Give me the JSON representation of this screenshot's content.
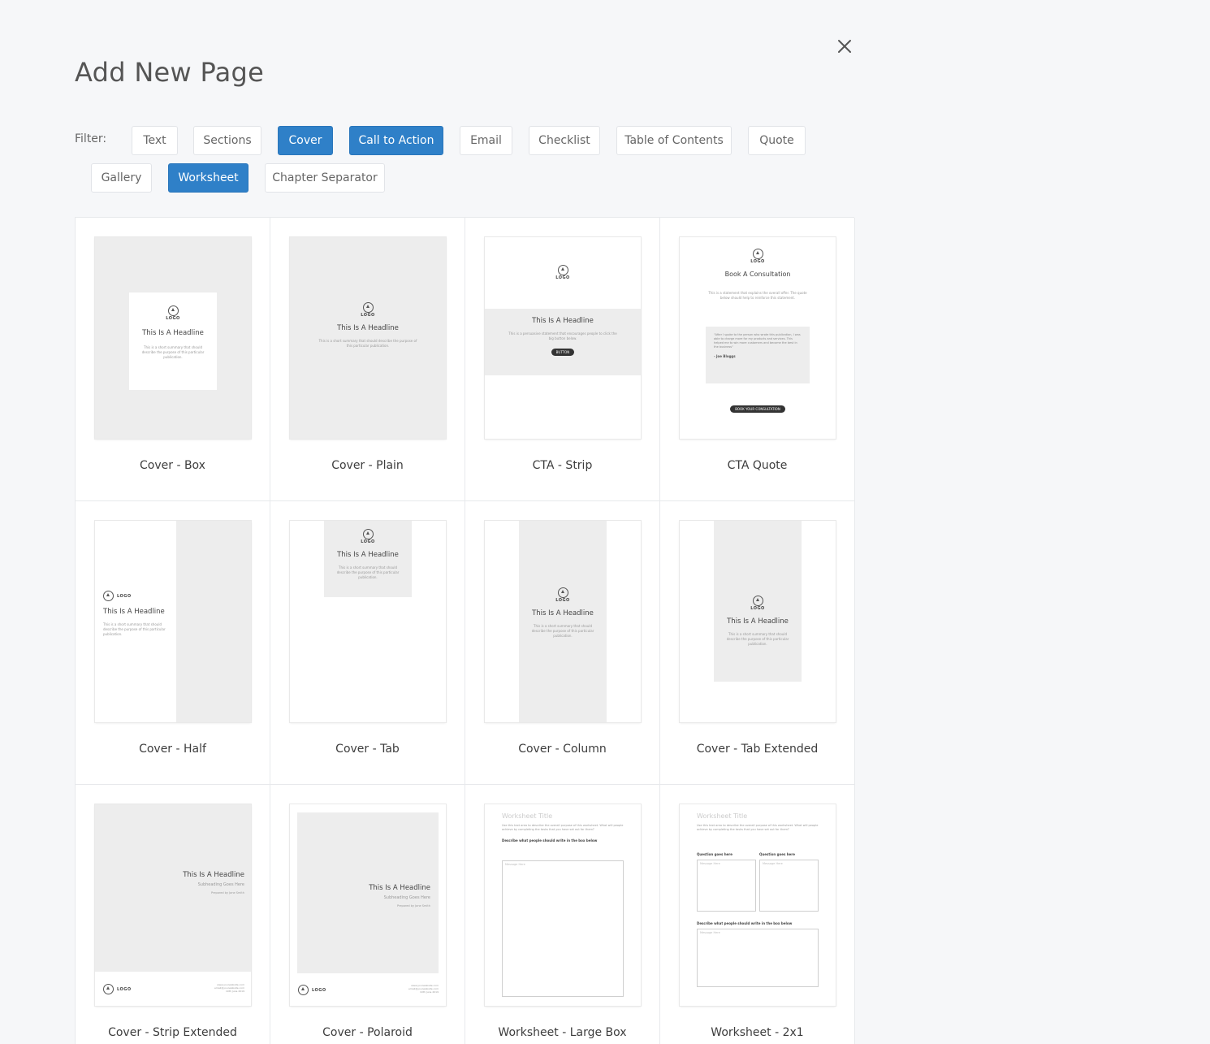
{
  "modal": {
    "title": "Add New Page",
    "close_icon": "close-icon"
  },
  "filter": {
    "label": "Filter:",
    "chips": [
      {
        "label": "Text",
        "active": false
      },
      {
        "label": "Sections",
        "active": false
      },
      {
        "label": "Cover",
        "active": true
      },
      {
        "label": "Call to Action",
        "active": true
      },
      {
        "label": "Email",
        "active": false
      },
      {
        "label": "Checklist",
        "active": false
      },
      {
        "label": "Table of Contents",
        "active": false
      },
      {
        "label": "Quote",
        "active": false
      },
      {
        "label": "Gallery",
        "active": false
      },
      {
        "label": "Worksheet",
        "active": true
      },
      {
        "label": "Chapter Separator",
        "active": false
      }
    ]
  },
  "colors": {
    "accent": "#2f80c8",
    "background": "#f6f7f9",
    "thumb_gray": "#ededed"
  },
  "thumb_text": {
    "logo": "LOGO",
    "headline": "This Is A Headline",
    "summary_box": "This is a short summary that should describe the purpose of this particular publication.",
    "summary_plain": "This is a short summary that should describe the purpose of this particular publication.",
    "cta_summary": "This is a persuasive statement that encourages people to click the big button below.",
    "button": "BUTTON",
    "consult_title": "Book A Consultation",
    "consult_text": "This is a statement that explains the overall offer. The quote below should help to reinforce this statement.",
    "consult_quote": "\"After I spoke to the person who wrote this publication, I was able to charge more for my products and services. This helped me to win more customers and become the best in the business\"",
    "consult_author": "- Joe Bloggs",
    "consult_button": "BOOK YOUR CONSULTATION",
    "subheading": "Subheading Goes Here",
    "prepared": "Prepared by Jane Smith",
    "footer_1": "www.yourwebsite.com",
    "footer_2": "email@yourwebsite.com",
    "footer_3": "10th June 2019",
    "ws_title": "Worksheet Title",
    "ws_intro": "Use this text area to describe the overall purpose of this worksheet. What will people achieve by completing the tasks that you have set out for them?",
    "ws_describe": "Describe what people should write in the box below",
    "ws_message": "Message Here",
    "ws_question": "Question goes here"
  },
  "templates": [
    {
      "name": "Cover - Box"
    },
    {
      "name": "Cover - Plain"
    },
    {
      "name": "CTA - Strip"
    },
    {
      "name": "CTA Quote"
    },
    {
      "name": "Cover - Half"
    },
    {
      "name": "Cover - Tab"
    },
    {
      "name": "Cover - Column"
    },
    {
      "name": "Cover - Tab Extended"
    },
    {
      "name": "Cover - Strip Extended"
    },
    {
      "name": "Cover - Polaroid"
    },
    {
      "name": "Worksheet - Large Box"
    },
    {
      "name": "Worksheet - 2x1"
    }
  ]
}
